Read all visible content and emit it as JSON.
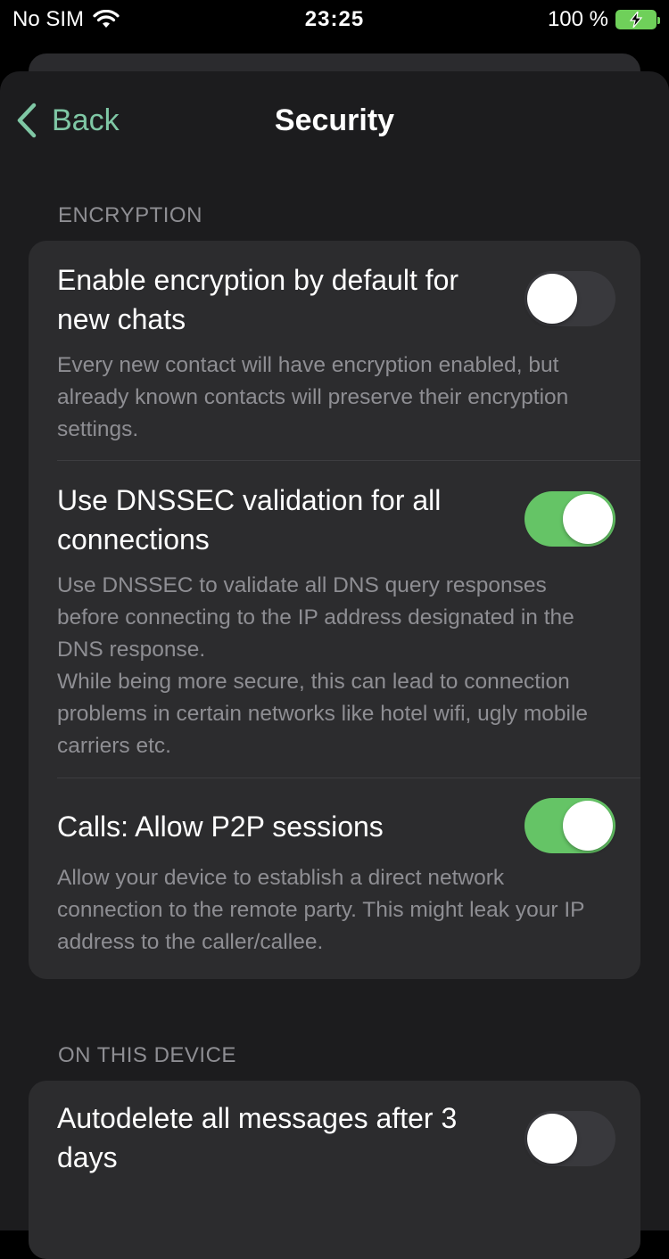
{
  "status_bar": {
    "carrier": "No SIM",
    "time": "23:25",
    "battery": "100 %"
  },
  "nav": {
    "back_label": "Back",
    "title": "Security"
  },
  "sections": {
    "encryption": {
      "header": "ENCRYPTION",
      "rows": [
        {
          "title": "Enable encryption by default for new chats",
          "description": "Every new contact will have encryption enabled, but already known contacts will preserve their encryption settings.",
          "toggle_on": false
        },
        {
          "title": "Use DNSSEC validation for all connections",
          "description": "Use DNSSEC to validate all DNS query responses before connecting to the IP address designated in the DNS response.\nWhile being more secure, this can lead to connection problems in certain networks like hotel wifi, ugly mobile carriers etc.",
          "toggle_on": true
        },
        {
          "title": "Calls: Allow P2P sessions",
          "description": "Allow your device to establish a direct network connection to the remote party. This might leak your IP address to the caller/callee.",
          "toggle_on": true
        }
      ]
    },
    "device": {
      "header": "ON THIS DEVICE",
      "rows": [
        {
          "title": "Autodelete all messages after 3 days",
          "toggle_on": false
        }
      ]
    }
  },
  "colors": {
    "accent": "#7fc7a5",
    "toggle_on": "#65c466",
    "toggle_off": "#39393d",
    "battery": "#6fd05a"
  },
  "icons": [
    "wifi-icon",
    "battery-charging-icon",
    "chevron-left-icon"
  ]
}
